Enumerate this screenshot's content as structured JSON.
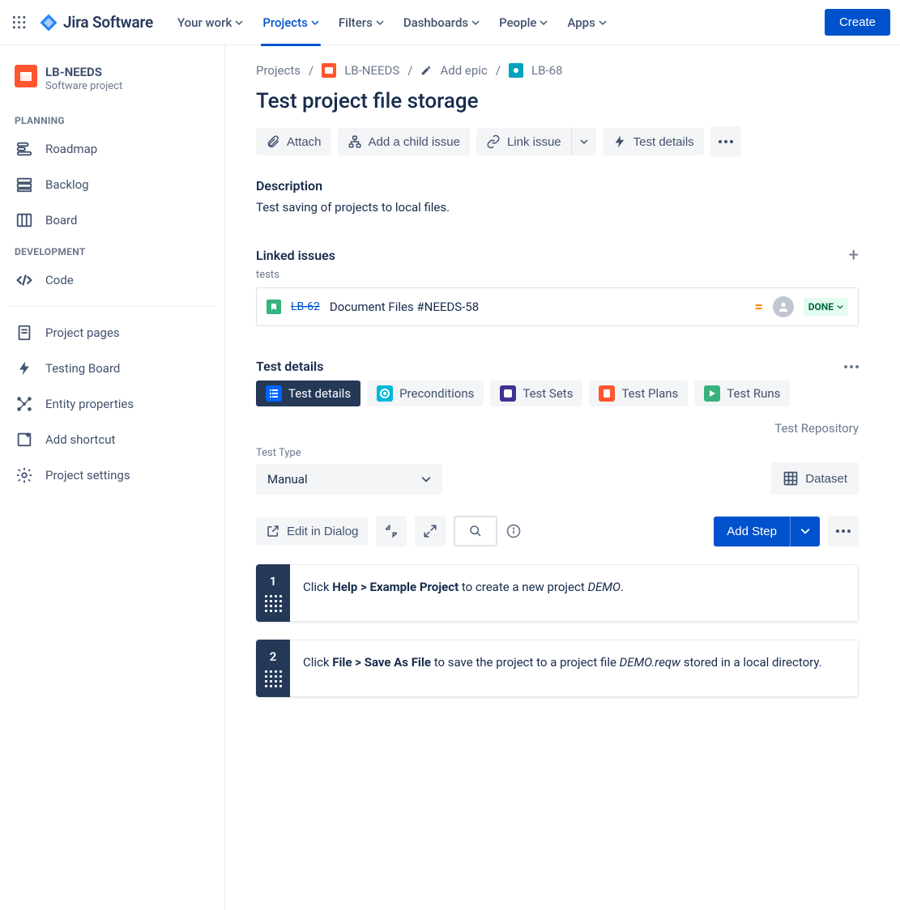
{
  "topnav": {
    "logo": "Jira Software",
    "items": [
      "Your work",
      "Projects",
      "Filters",
      "Dashboards",
      "People",
      "Apps"
    ],
    "active_index": 1,
    "create": "Create"
  },
  "sidebar": {
    "project_name": "LB-NEEDS",
    "project_type": "Software project",
    "sections": {
      "planning": {
        "label": "PLANNING",
        "items": [
          "Roadmap",
          "Backlog",
          "Board"
        ]
      },
      "development": {
        "label": "DEVELOPMENT",
        "items": [
          "Code"
        ]
      },
      "other": {
        "items": [
          "Project pages",
          "Testing Board",
          "Entity properties",
          "Add shortcut",
          "Project settings"
        ]
      }
    }
  },
  "breadcrumb": {
    "projects": "Projects",
    "project": "LB-NEEDS",
    "add_epic": "Add epic",
    "issue_key": "LB-68"
  },
  "issue": {
    "title": "Test project file storage",
    "actions": {
      "attach": "Attach",
      "add_child": "Add a child issue",
      "link": "Link issue",
      "test_details": "Test details"
    },
    "description_label": "Description",
    "description": "Test saving of projects to local files."
  },
  "linked": {
    "label": "Linked issues",
    "relation": "tests",
    "item": {
      "key": "LB-62",
      "title": "Document Files #NEEDS-58",
      "status": "DONE"
    }
  },
  "test_details": {
    "label": "Test details",
    "tabs": [
      "Test details",
      "Preconditions",
      "Test Sets",
      "Test Plans",
      "Test Runs"
    ],
    "repo": "Test Repository",
    "test_type_label": "Test Type",
    "test_type_value": "Manual",
    "dataset": "Dataset",
    "edit_dialog": "Edit in Dialog",
    "add_step": "Add Step"
  },
  "steps": [
    {
      "num": "1",
      "html": "Click <b>Help &gt; Example Project</b> to create a new project <i>DEMO</i>."
    },
    {
      "num": "2",
      "html": "Click <b>File &gt; Save As File</b> to save the project to a project file <i>DEMO.reqw</i> stored in a local directory."
    }
  ]
}
